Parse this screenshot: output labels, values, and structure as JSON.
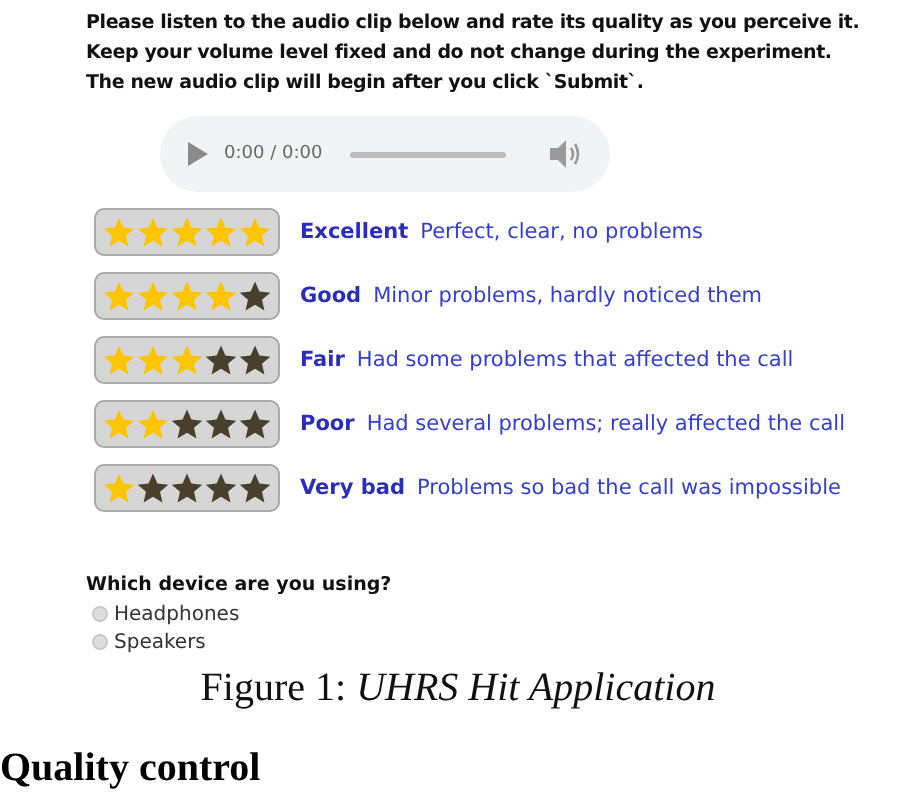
{
  "instructions": [
    "Please listen to the audio clip below and rate its quality as you perceive it.",
    "Keep your volume level fixed and do not change during the experiment.",
    "The new audio clip will begin after you click `Submit`."
  ],
  "audio_player": {
    "time": "0:00 / 0:00"
  },
  "ratings": [
    {
      "label": "Excellent",
      "description": "Perfect, clear, no problems",
      "stars": 5
    },
    {
      "label": "Good",
      "description": "Minor problems, hardly noticed them",
      "stars": 4
    },
    {
      "label": "Fair",
      "description": "Had some problems that affected the call",
      "stars": 3
    },
    {
      "label": "Poor",
      "description": "Had several problems; really affected the call",
      "stars": 2
    },
    {
      "label": "Very bad",
      "description": "Problems so bad the call was impossible",
      "stars": 1
    }
  ],
  "device_question": {
    "label": "Which device are you using?",
    "options": [
      {
        "label": "Headphones",
        "selected": false
      },
      {
        "label": "Speakers",
        "selected": false
      }
    ]
  },
  "caption": "Figure 1: *UHRS Hit Application*",
  "heading": "Quality control"
}
